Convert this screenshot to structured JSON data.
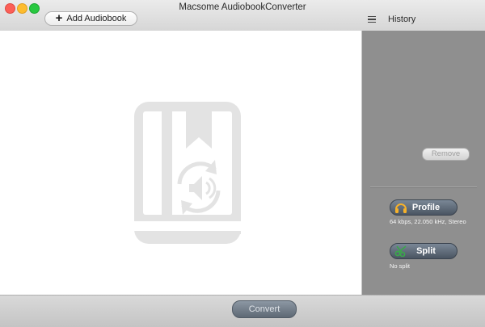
{
  "window": {
    "title": "Macsome AudiobookConverter"
  },
  "toolbar": {
    "add_label": "Add Audiobook",
    "add_icon": "plus-icon",
    "history_label": "History",
    "history_icon": "list-icon"
  },
  "main": {
    "placeholder_icon": "audiobook-placeholder-icon"
  },
  "sidebar": {
    "remove_label": "Remove",
    "profile": {
      "label": "Profile",
      "icon": "headphones-icon",
      "info": "64  kbps, 22.050 kHz, Stereo"
    },
    "split": {
      "label": "Split",
      "icon": "scissors-icon",
      "info": "No split"
    }
  },
  "footer": {
    "convert_label": "Convert"
  },
  "colors": {
    "sidebar_bg": "#8f8f8f",
    "pill_button": "#5b6672",
    "placeholder_icon": "#e3e3e3"
  }
}
